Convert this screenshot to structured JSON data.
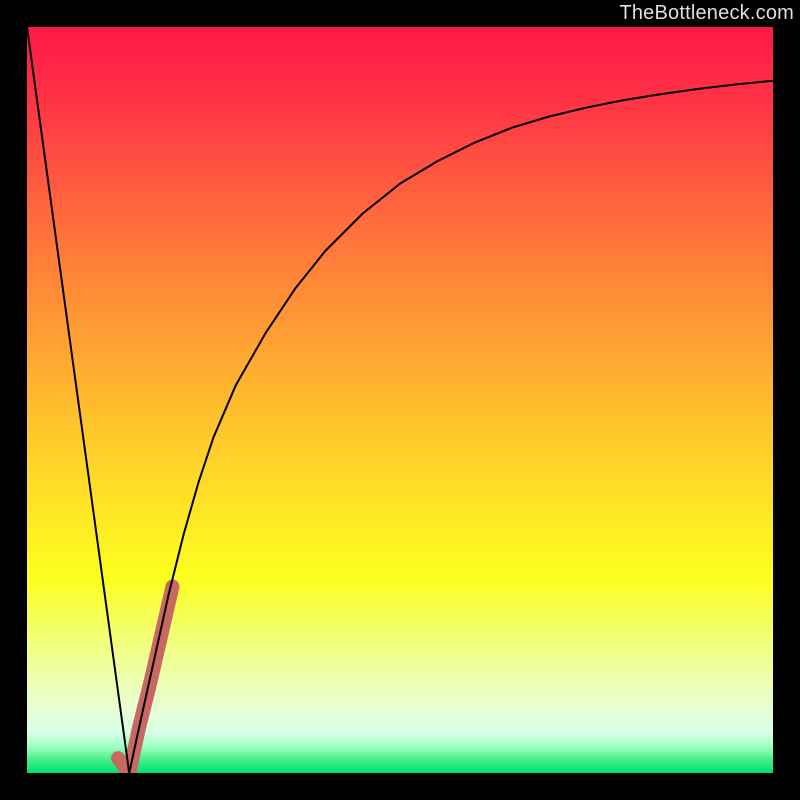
{
  "watermark": "TheBottleneck.com",
  "chart_data": {
    "type": "line",
    "title": "",
    "xlabel": "",
    "ylabel": "",
    "xlim": [
      0,
      100
    ],
    "ylim": [
      0,
      100
    ],
    "grid": false,
    "legend": false,
    "series": [
      {
        "name": "bottleneck-curve",
        "color": "#000000",
        "stroke_width": 2,
        "x": [
          0,
          2,
          4,
          6,
          8,
          10,
          12,
          13.7,
          15,
          17,
          19,
          21,
          23,
          25,
          28,
          32,
          36,
          40,
          45,
          50,
          55,
          60,
          65,
          70,
          75,
          80,
          85,
          90,
          95,
          100
        ],
        "y": [
          100,
          85.4,
          70.8,
          56.2,
          41.6,
          27.0,
          12.4,
          0,
          6,
          15,
          24,
          32,
          39,
          45,
          52,
          59,
          65,
          70,
          75,
          79,
          82,
          84.5,
          86.5,
          88,
          89.2,
          90.2,
          91,
          91.7,
          92.3,
          92.8
        ]
      },
      {
        "name": "highlight-segment",
        "color": "#C96762",
        "stroke_width": 14,
        "x": [
          12.2,
          13.7,
          15.0,
          16.5,
          18.0,
          19.5
        ],
        "y": [
          2.0,
          0.0,
          6.0,
          12.0,
          18.5,
          25.0
        ]
      }
    ],
    "background_gradient": {
      "stops": [
        {
          "offset": 0.0,
          "color": "#ff1846"
        },
        {
          "offset": 0.1,
          "color": "#ff3346"
        },
        {
          "offset": 0.2,
          "color": "#ff5740"
        },
        {
          "offset": 0.3,
          "color": "#ff7a3a"
        },
        {
          "offset": 0.4,
          "color": "#ff9a34"
        },
        {
          "offset": 0.5,
          "color": "#ffba2e"
        },
        {
          "offset": 0.6,
          "color": "#ffd828"
        },
        {
          "offset": 0.68,
          "color": "#ffee22"
        },
        {
          "offset": 0.74,
          "color": "#fcff20"
        },
        {
          "offset": 0.8,
          "color": "#f4ff60"
        },
        {
          "offset": 0.86,
          "color": "#eeffa0"
        },
        {
          "offset": 0.91,
          "color": "#e8ffd0"
        },
        {
          "offset": 0.945,
          "color": "#d8ffe8"
        },
        {
          "offset": 0.965,
          "color": "#a0ffc0"
        },
        {
          "offset": 0.98,
          "color": "#50f090"
        },
        {
          "offset": 1.0,
          "color": "#00e070"
        }
      ]
    }
  }
}
